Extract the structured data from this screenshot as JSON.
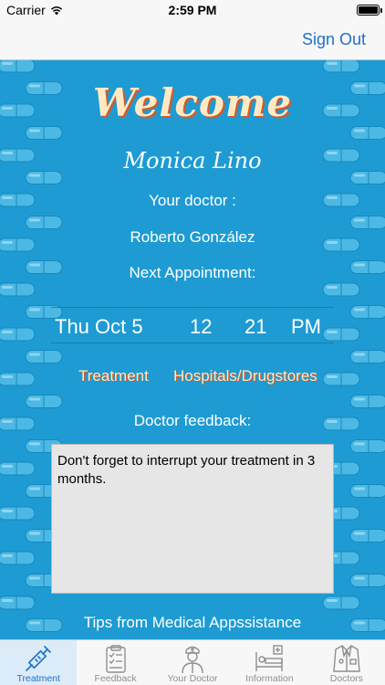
{
  "status_bar": {
    "carrier": "Carrier",
    "time": "2:59 PM"
  },
  "nav": {
    "sign_out": "Sign Out"
  },
  "main": {
    "welcome": "Welcome",
    "patient_name": "Monica Lino",
    "doctor_label": "Your doctor :",
    "doctor_name": "Roberto González",
    "appointment_label": "Next Appointment:",
    "appointment": {
      "date": "Thu Oct 5",
      "hour": "12",
      "minute": "21",
      "ampm": "PM"
    },
    "treatment_button": "Treatment",
    "hospitals_button": "Hospitals/Drugstores",
    "feedback_label": "Doctor feedback:",
    "feedback_text": "Don't forget to interrupt your treatment in 3 months.",
    "tips_label": "Tips from Medical Appssistance"
  },
  "tabs": [
    {
      "label": "Treatment",
      "icon": "syringe-icon",
      "active": true
    },
    {
      "label": "Feedback",
      "icon": "clipboard-icon",
      "active": false
    },
    {
      "label": "Your Doctor",
      "icon": "doctor-icon",
      "active": false
    },
    {
      "label": "Information",
      "icon": "hospital-bed-icon",
      "active": false
    },
    {
      "label": "Doctors",
      "icon": "lab-coat-icon",
      "active": false
    }
  ],
  "colors": {
    "accent": "#1f6fc9",
    "background": "#1e9bd2",
    "welcome": "#ffe9c4",
    "shadow": "#d35b2a"
  }
}
